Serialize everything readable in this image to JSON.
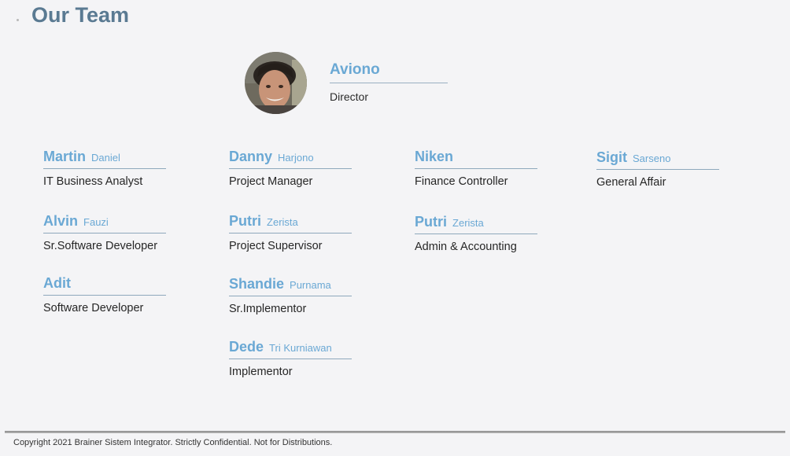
{
  "page": {
    "title": "Our Team",
    "footer": "Copyright 2021 Brainer Sistem Integrator. Strictly Confidential. Not for Distributions."
  },
  "director": {
    "name": "Aviono",
    "role": "Director"
  },
  "members": [
    {
      "first": "Martin",
      "last": "Daniel",
      "role": "IT Business Analyst"
    },
    {
      "first": "Alvin",
      "last": "Fauzi",
      "role": "Sr.Software Developer"
    },
    {
      "first": "Adit",
      "last": "",
      "role": "Software Developer"
    },
    {
      "first": "Danny",
      "last": "Harjono",
      "role": "Project Manager"
    },
    {
      "first": "Putri",
      "last": "Zerista",
      "role": "Project Supervisor"
    },
    {
      "first": "Shandie",
      "last": "Purnama",
      "role": "Sr.Implementor"
    },
    {
      "first": "Dede",
      "last": "Tri Kurniawan",
      "role": "Implementor"
    },
    {
      "first": "Niken",
      "last": "",
      "role": "Finance Controller"
    },
    {
      "first": "Putri",
      "last": "Zerista",
      "role": "Admin & Accounting"
    },
    {
      "first": "Sigit",
      "last": "Sarseno",
      "role": "General Affair"
    }
  ],
  "colors": {
    "title": "#5a7a92",
    "name": "#6aa8d4",
    "text": "#262626",
    "background": "#f4f4f6"
  }
}
